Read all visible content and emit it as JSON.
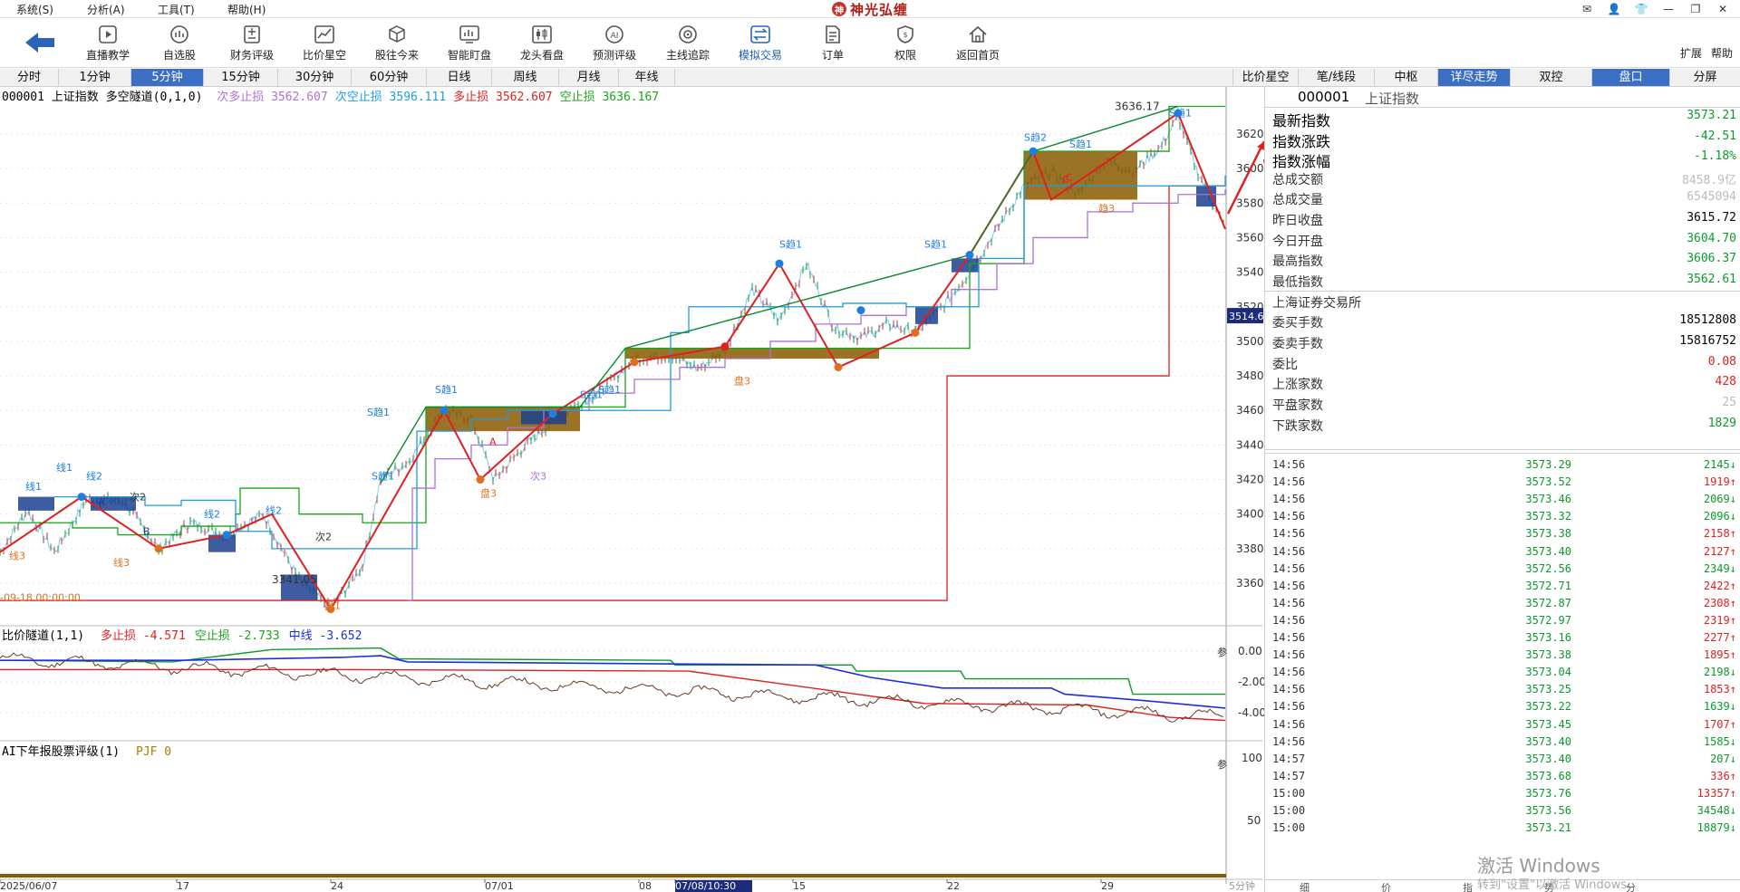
{
  "menu": {
    "items": [
      {
        "label": "系统(S)"
      },
      {
        "label": "分析(A)"
      },
      {
        "label": "工具(T)"
      },
      {
        "label": "帮助(H)"
      }
    ],
    "brand": "神光弘缠",
    "brand_logo": "神"
  },
  "toolbar": {
    "items": [
      {
        "label": "直播教学",
        "icon": "play-icon"
      },
      {
        "label": "自选股",
        "icon": "gauge-icon"
      },
      {
        "label": "财务评级",
        "icon": "calc-icon"
      },
      {
        "label": "比价星空",
        "icon": "chart-line-icon"
      },
      {
        "label": "股往今来",
        "icon": "cube-icon"
      },
      {
        "label": "智能盯盘",
        "icon": "monitor-chart-icon"
      },
      {
        "label": "龙头看盘",
        "icon": "candlestick-icon"
      },
      {
        "label": "预测评级",
        "icon": "ai-icon"
      },
      {
        "label": "主线追踪",
        "icon": "target-icon"
      },
      {
        "label": "模拟交易",
        "icon": "swap-icon"
      },
      {
        "label": "订单",
        "icon": "document-icon"
      },
      {
        "label": "权限",
        "icon": "shield-icon"
      },
      {
        "label": "返回首页",
        "icon": "home-icon"
      }
    ],
    "right_expand": "扩展",
    "right_help": "帮助"
  },
  "periods": [
    "分时",
    "1分钟",
    "5分钟",
    "15分钟",
    "30分钟",
    "60分钟",
    "日线",
    "周线",
    "月线",
    "年线"
  ],
  "active_period": "5分钟",
  "right_tabs": [
    "比价星空",
    "笔/线段",
    "中枢",
    "详尽走势",
    "双控",
    "盘口",
    "分屏"
  ],
  "right_active_tabs": [
    "详尽走势",
    "盘口"
  ],
  "main_legend": {
    "code_name": "000001 上证指数 多空隧道(0,1,0)",
    "items": [
      {
        "label": "次多止损",
        "value": "3562.607",
        "color": "#b06fd6"
      },
      {
        "label": "次空止损",
        "value": "3596.111",
        "color": "#1d9ce0"
      },
      {
        "label": "多止损",
        "value": "3562.607",
        "color": "#e02020"
      },
      {
        "label": "空止损",
        "value": "3636.167",
        "color": "#1aa51a"
      }
    ]
  },
  "sub1_legend": {
    "name": "比价隧道(1,1)",
    "items": [
      {
        "label": "多止损",
        "value": "-4.571",
        "color": "#e02020"
      },
      {
        "label": "空止损",
        "value": "-2.733",
        "color": "#1aa51a"
      },
      {
        "label": "中线",
        "value": "-3.652",
        "color": "#1a2ee0"
      }
    ]
  },
  "sub2_legend": {
    "name": "AI下年报股票评级(1)",
    "item": "PJF 0"
  },
  "price_axis": [
    "3620",
    "3600",
    "3580",
    "3560",
    "3540",
    "3520",
    "3500",
    "3480",
    "3460",
    "3440",
    "3420",
    "3400",
    "3380",
    "3360"
  ],
  "current_price_tag": "3514.6",
  "high_label": "3636.17",
  "low_label": "3341.05",
  "cursor_time": "-09-18 00:00:00",
  "sub1_axis": [
    "0.00",
    "-2.00",
    "-4.00"
  ],
  "sub2_axis": [
    "100",
    "50"
  ],
  "x_axis": [
    "2025/06/07",
    "17",
    "24",
    "07/01",
    "08",
    "07/08/10:30",
    "15",
    "22",
    "29"
  ],
  "x_tail": "5分钟",
  "ref_marker": "参",
  "annotations": {
    "s_trend": [
      "S趋1",
      "S趋1",
      "S趋1",
      "S趋1",
      "S趋1",
      "S趋1",
      "S趋1",
      "S趋2",
      "S趋1",
      "S趋1"
    ],
    "trend_labels": [
      "线1",
      "线1",
      "线2",
      "线2",
      "线2",
      "线3",
      "线3",
      "次2",
      "次2",
      "次3",
      "趋3",
      "盘3",
      "盘1",
      "盘3"
    ],
    "letters": [
      "A",
      "B",
      "C",
      "A",
      "C"
    ]
  },
  "quote": {
    "code": "000001",
    "name": "上证指数",
    "rows": [
      {
        "label": "最新指数",
        "value": "3573.21",
        "color": "#0a9a2a",
        "big": true
      },
      {
        "label": "指数涨跌",
        "value": "-42.51",
        "color": "#0a9a2a",
        "big": true
      },
      {
        "label": "指数涨幅",
        "value": "-1.18%",
        "color": "#0a9a2a",
        "big": true
      },
      {
        "label": "总成交额",
        "value": "8458.9亿",
        "color": "#bbbbbb",
        "big": false
      },
      {
        "label": "总成交量",
        "value": "6545094",
        "color": "#bbbbbb",
        "big": false
      },
      {
        "label": "昨日收盘",
        "value": "3615.72",
        "color": "#000000",
        "big": false
      },
      {
        "label": "今日开盘",
        "value": "3604.70",
        "color": "#0a9a2a",
        "big": false
      },
      {
        "label": "最高指数",
        "value": "3606.37",
        "color": "#0a9a2a",
        "big": false
      },
      {
        "label": "最低指数",
        "value": "3562.61",
        "color": "#0a9a2a",
        "big": false
      }
    ],
    "exchange": "上海证券交易所",
    "rows2": [
      {
        "label": "委买手数",
        "value": "18512808",
        "color": "#000000"
      },
      {
        "label": "委卖手数",
        "value": "15816752",
        "color": "#000000"
      },
      {
        "label": "委比",
        "value": "0.08",
        "color": "#e02020"
      },
      {
        "label": "上涨家数",
        "value": "428",
        "color": "#e02020"
      },
      {
        "label": "平盘家数",
        "value": "25",
        "color": "#bbbbbb"
      },
      {
        "label": "下跌家数",
        "value": "1829",
        "color": "#0a9a2a"
      }
    ]
  },
  "ticks": [
    {
      "time": "14:56",
      "price": "3573.29",
      "vol": "2145",
      "dir": "down"
    },
    {
      "time": "14:56",
      "price": "3573.52",
      "vol": "1919",
      "dir": "up"
    },
    {
      "time": "14:56",
      "price": "3573.46",
      "vol": "2069",
      "dir": "down"
    },
    {
      "time": "14:56",
      "price": "3573.32",
      "vol": "2096",
      "dir": "down"
    },
    {
      "time": "14:56",
      "price": "3573.38",
      "vol": "2158",
      "dir": "up"
    },
    {
      "time": "14:56",
      "price": "3573.40",
      "vol": "2127",
      "dir": "up"
    },
    {
      "time": "14:56",
      "price": "3572.56",
      "vol": "2349",
      "dir": "down"
    },
    {
      "time": "14:56",
      "price": "3572.71",
      "vol": "2422",
      "dir": "up"
    },
    {
      "time": "14:56",
      "price": "3572.87",
      "vol": "2308",
      "dir": "up"
    },
    {
      "time": "14:56",
      "price": "3572.97",
      "vol": "2319",
      "dir": "up"
    },
    {
      "time": "14:56",
      "price": "3573.16",
      "vol": "2277",
      "dir": "up"
    },
    {
      "time": "14:56",
      "price": "3573.38",
      "vol": "1895",
      "dir": "up"
    },
    {
      "time": "14:56",
      "price": "3573.04",
      "vol": "2198",
      "dir": "down"
    },
    {
      "time": "14:56",
      "price": "3573.25",
      "vol": "1853",
      "dir": "up"
    },
    {
      "time": "14:56",
      "price": "3573.22",
      "vol": "1639",
      "dir": "down"
    },
    {
      "time": "14:56",
      "price": "3573.45",
      "vol": "1707",
      "dir": "up"
    },
    {
      "time": "14:56",
      "price": "3573.40",
      "vol": "1585",
      "dir": "down"
    },
    {
      "time": "14:57",
      "price": "3573.40",
      "vol": "207",
      "dir": "down"
    },
    {
      "time": "14:57",
      "price": "3573.68",
      "vol": "336",
      "dir": "up"
    },
    {
      "time": "15:00",
      "price": "3573.76",
      "vol": "13357",
      "dir": "up"
    },
    {
      "time": "15:00",
      "price": "3573.56",
      "vol": "34548",
      "dir": "down"
    },
    {
      "time": "15:00",
      "price": "3573.21",
      "vol": "18879",
      "dir": "down"
    }
  ],
  "bottom_tabs": [
    "细",
    "价",
    "指",
    "势",
    "分"
  ],
  "watermark": {
    "line1": "激活 Windows",
    "line2": "转到\"设置\"以激活 Windows。"
  },
  "colors": {
    "accent": "#3b6fc4",
    "up": "#e02020",
    "down": "#0a9a2a"
  }
}
